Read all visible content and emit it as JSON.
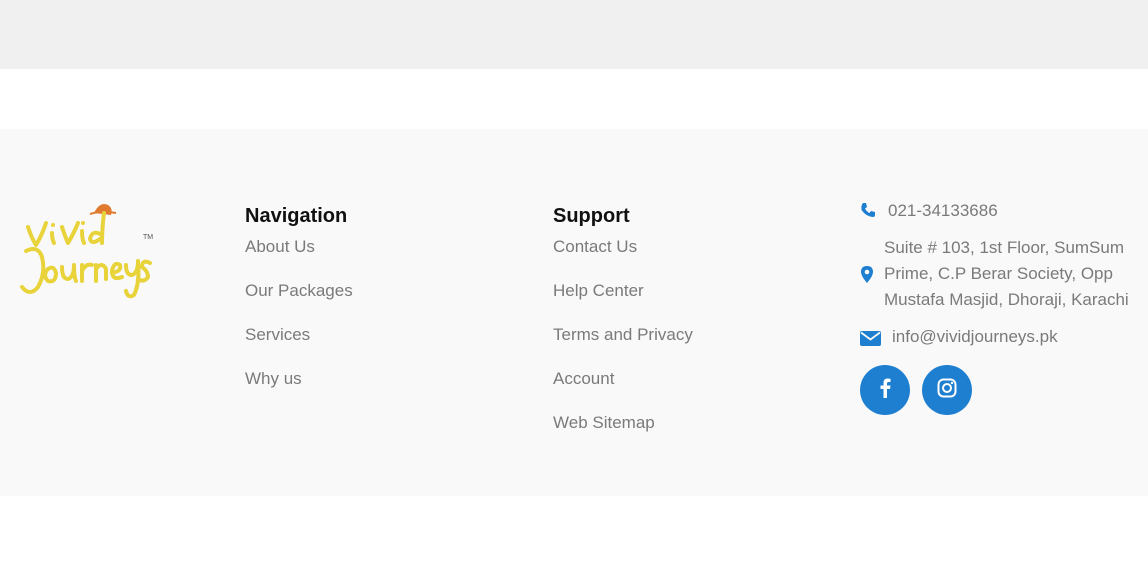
{
  "brand": {
    "logo_line1": "Vivid",
    "logo_line2": "Journeys",
    "logo_tm": "TM",
    "logo_color": "#e8d33a",
    "hat_color": "#e07a2e"
  },
  "navigation": {
    "heading": "Navigation",
    "links": [
      "About Us",
      "Our Packages",
      "Services",
      "Why us"
    ]
  },
  "support": {
    "heading": "Support",
    "links": [
      "Contact Us",
      "Help Center",
      "Terms and Privacy",
      "Account",
      "Web Sitemap"
    ]
  },
  "contact": {
    "phone": "021-34133686",
    "address_lines": [
      "Suite # 103, 1st Floor, SumSum",
      "Prime, C.P Berar Society, Opp",
      "Mustafa Masjid, Dhoraji, Karachi"
    ],
    "email": "info@vividjourneys.pk",
    "icon_color": "#1e7fd0"
  },
  "social": {
    "items": [
      "facebook-icon",
      "instagram-icon"
    ],
    "button_color": "#1e7fd0"
  }
}
